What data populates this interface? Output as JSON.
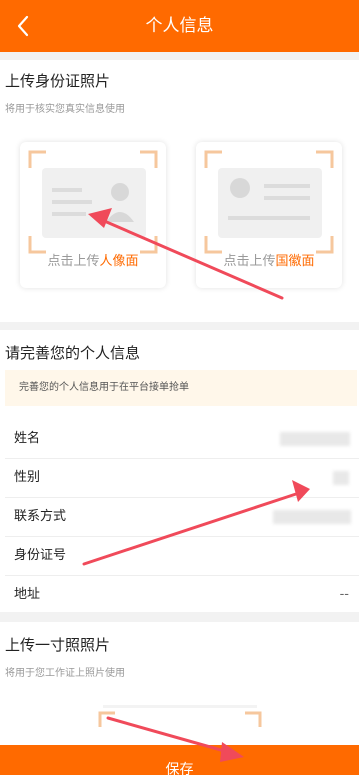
{
  "header": {
    "title": "个人信息"
  },
  "upload_id": {
    "title": "上传身份证照片",
    "subtitle": "将用于核实您真实信息使用",
    "front": {
      "prefix": "点击上传",
      "highlight": "人像面"
    },
    "back": {
      "prefix": "点击上传",
      "highlight": "国徽面"
    }
  },
  "personal_info": {
    "title": "请完善您的个人信息",
    "notice": "完善您的个人信息用于在平台接单抢单",
    "fields": [
      {
        "label": "姓名",
        "value": ""
      },
      {
        "label": "性别",
        "value": ""
      },
      {
        "label": "联系方式",
        "value": ""
      },
      {
        "label": "身份证号",
        "value": ""
      },
      {
        "label": "地址",
        "value": "--"
      }
    ]
  },
  "upload_photo": {
    "title": "上传一寸照照片",
    "subtitle": "将用于您工作证上照片使用"
  },
  "footer": {
    "save_label": "保存"
  },
  "colors": {
    "accent": "#ff6a00",
    "annotation": "#f04a5a"
  }
}
